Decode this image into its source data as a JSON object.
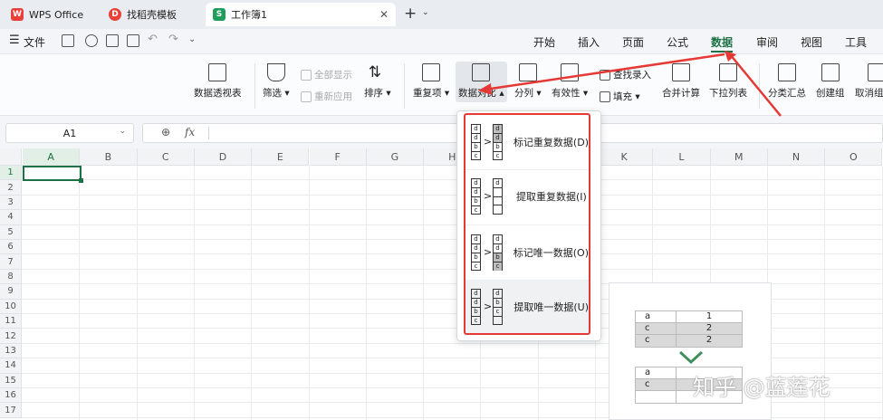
{
  "tabs": [
    {
      "label": "WPS Office"
    },
    {
      "label": "找稻壳模板"
    },
    {
      "label": "工作簿1"
    }
  ],
  "logos": {
    "wps": "W",
    "docer": "D",
    "sheet": "S"
  },
  "menu": {
    "file": "文件",
    "ribbon_tabs": [
      "开始",
      "插入",
      "页面",
      "公式",
      "数据",
      "审阅",
      "视图",
      "工具"
    ],
    "active_tab": "数据"
  },
  "ribbon": {
    "pivot": "数据透视表",
    "filter": "筛选",
    "show_all": "全部显示",
    "reapply": "重新应用",
    "sort": "排序",
    "duplicates": "重复项",
    "compare": "数据对比",
    "split": "分列",
    "validity": "有效性",
    "lookup_entry": "查找录入",
    "fill": "填充",
    "merge_calc": "合并计算",
    "dropdown_list": "下拉列表",
    "subtotal": "分类汇总",
    "group": "创建组",
    "ungroup": "取消组"
  },
  "formula_bar": {
    "cell_ref": "A1",
    "fx": "fx"
  },
  "columns": [
    "A",
    "B",
    "C",
    "D",
    "E",
    "F",
    "G",
    "H",
    "I",
    "J",
    "K",
    "L",
    "M",
    "N",
    "O"
  ],
  "rows": [
    "1",
    "2",
    "3",
    "4",
    "5",
    "6",
    "7",
    "8",
    "9",
    "10",
    "11",
    "12",
    "13",
    "14",
    "15",
    "16",
    "17"
  ],
  "compare_menu": [
    {
      "label": "标记重复数据(D)",
      "left": [
        "d",
        "d",
        "b",
        "c"
      ],
      "right": [
        "d",
        "d",
        "b",
        "c"
      ]
    },
    {
      "label": "提取重复数据(I)",
      "left": [
        "d",
        "d",
        "b",
        "c"
      ],
      "right": [
        "d",
        "",
        "",
        ""
      ]
    },
    {
      "label": "标记唯一数据(O)",
      "left": [
        "d",
        "d",
        "b",
        "c"
      ],
      "right": [
        "d",
        "d",
        "b",
        "c"
      ]
    },
    {
      "label": "提取唯一数据(U)",
      "left": [
        "d",
        "d",
        "b",
        "c"
      ],
      "right": [
        "d",
        "b",
        "c",
        ""
      ]
    }
  ],
  "illustration": {
    "top_table": [
      [
        "a",
        "1"
      ],
      [
        "c",
        "2"
      ],
      [
        "c",
        "2"
      ]
    ],
    "bottom_table": [
      [
        "a",
        ""
      ],
      [
        "c",
        ""
      ],
      [
        "",
        ""
      ]
    ]
  },
  "watermark": "知乎 @蓝莲花",
  "colors": {
    "accent_green": "#1e7145",
    "highlight_red": "#e53935",
    "wps_red": "#e8413a"
  }
}
